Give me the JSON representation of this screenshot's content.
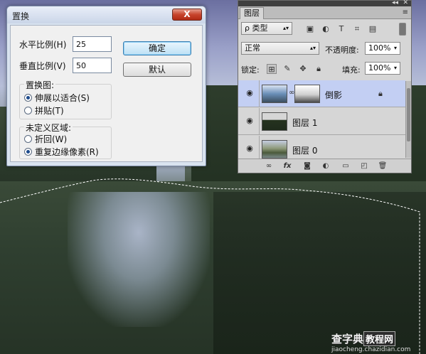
{
  "dialog": {
    "title": "置换",
    "close_glyph": "X",
    "horizontal_label": "水平比例(H)",
    "horizontal_value": "25",
    "vertical_label": "垂直比例(V)",
    "vertical_value": "50",
    "ok_label": "确定",
    "default_label": "默认",
    "map_group_title": "置换图:",
    "map_options": [
      "伸展以适合(S)",
      "拼贴(T)"
    ],
    "undefined_group_title": "未定义区域:",
    "undefined_options": [
      "折回(W)",
      "重复边缘像素(R)"
    ]
  },
  "layers_panel": {
    "tab_label": "图层",
    "filter_label": "ρ 类型",
    "blend_mode": "正常",
    "opacity_label": "不透明度:",
    "opacity_value": "100%",
    "lock_label": "锁定:",
    "fill_label": "填充:",
    "fill_value": "100%",
    "layers": [
      {
        "name": "倒影",
        "active": true,
        "has_mask": true,
        "locked": true
      },
      {
        "name": "图层 1",
        "active": false
      },
      {
        "name": "图层 0",
        "active": false
      }
    ]
  },
  "icons": {
    "eye": "eye-icon",
    "link": "link-icon",
    "fx": "fx-icon",
    "lock": "lock-icon"
  },
  "watermark": {
    "main_text": "查字典",
    "box_text": "教程网",
    "sub_text": "jiaocheng.chazidian.com"
  }
}
